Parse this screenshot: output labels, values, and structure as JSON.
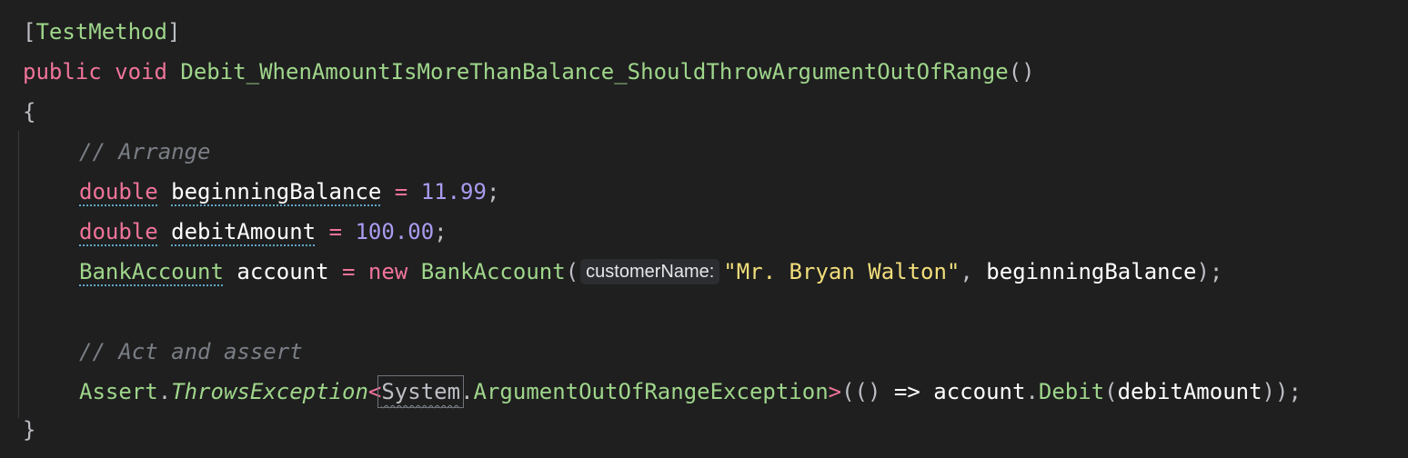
{
  "code": {
    "l1": {
      "open": "[",
      "attr": "TestMethod",
      "close": "]"
    },
    "l2": {
      "kw_public": "public",
      "kw_void": "void",
      "method": "Debit_WhenAmountIsMoreThanBalance_ShouldThrowArgumentOutOfRange",
      "parens": "()"
    },
    "l3": {
      "brace": "{"
    },
    "l4": {
      "comment": "// Arrange"
    },
    "l5": {
      "type": "double",
      "name": "beginningBalance",
      "eq": "=",
      "value": "11.99",
      "semi": ";"
    },
    "l6": {
      "type": "double",
      "name": "debitAmount",
      "eq": "=",
      "value": "100.00",
      "semi": ";"
    },
    "l7": {
      "type": "BankAccount",
      "name": "account",
      "eq": "=",
      "kw_new": "new",
      "ctor": "BankAccount",
      "paren_open": "(",
      "param_hint": "customerName:",
      "arg_string": "\"Mr. Bryan Walton\"",
      "comma": ",",
      "arg_var": "beginningBalance",
      "paren_close": ");"
    },
    "l8": {
      "comment": "// Act and assert"
    },
    "l9": {
      "cls": "Assert",
      "dot1": ".",
      "method": "ThrowsException",
      "lt": "<",
      "ns": "System",
      "dot2": ".",
      "exc": "ArgumentOutOfRangeException",
      "gt": ">",
      "lambda_open": "(()",
      "arrow": "=>",
      "obj": "account",
      "dot3": ".",
      "call": "Debit",
      "call_open": "(",
      "arg": "debitAmount",
      "call_close": "));"
    },
    "l10": {
      "brace": "}"
    }
  },
  "colors": {
    "background": "#1f1f1f",
    "keyword": "#f0749a",
    "method": "#9fd68b",
    "number": "#a99bf0",
    "string": "#f2de7c",
    "comment": "#7a7e85"
  }
}
